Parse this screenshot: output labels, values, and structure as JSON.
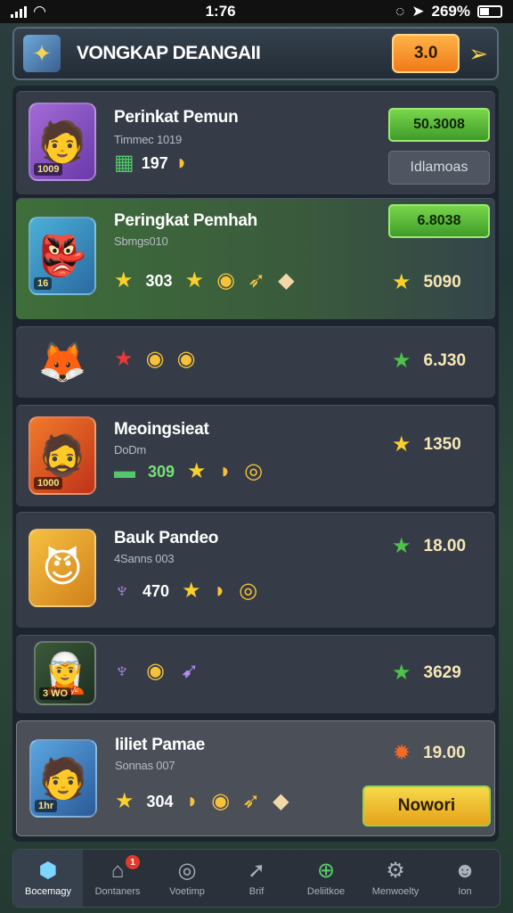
{
  "status_bar": {
    "time": "1:76",
    "battery": "269%"
  },
  "header": {
    "title": "VONGKAP DEANGAII",
    "currency_button": "3.0",
    "send_icon": "paper-plane-icon",
    "logo_icon": "shield-emblem-icon"
  },
  "rows": [
    {
      "avatar_icon": "purple-hero-avatar",
      "avatar_tag": "1009",
      "name": "Perinkat Pemun",
      "subtitle": "Timmec 1019",
      "stat_value": "197",
      "button_primary": "50.3008",
      "button_secondary": "Idlamoas"
    },
    {
      "avatar_icon": "green-goblin-avatar",
      "avatar_tag": "16",
      "name": "Peringkat Pemhah",
      "subtitle": "Sbmgs010",
      "stat_value": "303",
      "button_primary": "6.8038",
      "score": "5090"
    },
    {
      "avatar_icon": "fox-creature-avatar",
      "score": "6.J30"
    },
    {
      "avatar_icon": "fire-warrior-avatar",
      "avatar_tag": "1000",
      "name": "Meoingsieat",
      "subtitle": "DoDm",
      "stat_value": "309",
      "score": "1350"
    },
    {
      "avatar_icon": "horned-jester-avatar",
      "name": "Bauk Pandeo",
      "subtitle": "4Sanns 003",
      "stat_value": "470",
      "score": "18.00"
    },
    {
      "avatar_icon": "shadow-rogue-avatar",
      "avatar_tag": "3 WO",
      "score": "3629"
    },
    {
      "avatar_icon": "horned-hero-avatar",
      "avatar_tag": "1hr",
      "name": "Iiliet Pamae",
      "subtitle": "Sonnas 007",
      "stat_value": "304",
      "score": "19.00",
      "action_button": "Nowori"
    }
  ],
  "nav": [
    {
      "label": "Bocemagy",
      "icon": "cube-icon"
    },
    {
      "label": "Dontaners",
      "icon": "dungeon-icon",
      "badge": "1"
    },
    {
      "label": "Voetimp",
      "icon": "target-icon"
    },
    {
      "label": "Brif",
      "icon": "wing-icon"
    },
    {
      "label": "Deliitkoe",
      "icon": "plus-circle-icon"
    },
    {
      "label": "Menwoelty",
      "icon": "settings-icon"
    },
    {
      "label": "Ion",
      "icon": "person-icon"
    }
  ]
}
